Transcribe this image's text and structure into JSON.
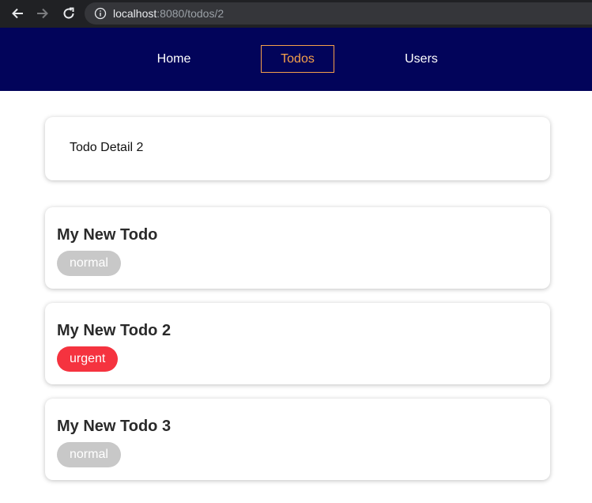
{
  "browser": {
    "url_host": "localhost",
    "url_rest": ":8080/todos/2"
  },
  "nav": {
    "items": [
      {
        "label": "Home",
        "active": false
      },
      {
        "label": "Todos",
        "active": true
      },
      {
        "label": "Users",
        "active": false
      }
    ]
  },
  "detail": {
    "title": "Todo Detail 2"
  },
  "todos": [
    {
      "title": "My New Todo",
      "priority": "normal",
      "color": "#c8c8c8"
    },
    {
      "title": "My New Todo 2",
      "priority": "urgent",
      "color": "#f5333f"
    },
    {
      "title": "My New Todo 3",
      "priority": "normal",
      "color": "#c8c8c8"
    }
  ],
  "colors": {
    "header_bg": "#02045a",
    "active_nav": "#f5a04a"
  }
}
